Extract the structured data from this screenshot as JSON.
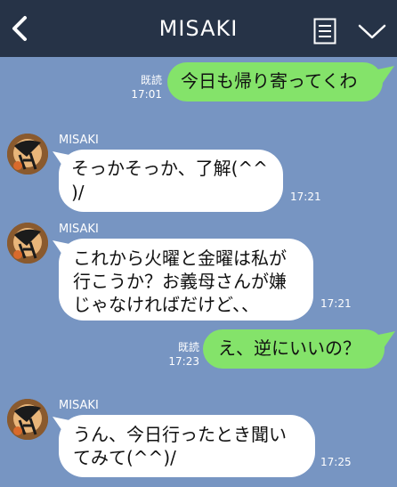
{
  "header": {
    "title": "MISAKI",
    "back_icon": "chevron-left-icon",
    "note_icon": "note-icon",
    "menu_icon": "chevron-down-icon",
    "background": "#263347"
  },
  "chat_background": "#7795c2",
  "messages": [
    {
      "direction": "out",
      "text": "今日も帰り寄ってくわ",
      "read_label": "既読",
      "time": "17:01"
    },
    {
      "direction": "in",
      "sender": "MISAKI",
      "text_line1": "そっかそっか、了解(^^",
      "text_line2": ")/",
      "time": "17:21"
    },
    {
      "direction": "in",
      "sender": "MISAKI",
      "text_line1": "これから火曜と金曜は私が",
      "text_line2": "行こうか？お義母さんが嫌",
      "text_line3": "じゃなければだけど、、",
      "time": "17:21"
    },
    {
      "direction": "out",
      "text": "え、逆にいいの？",
      "read_label": "既読",
      "time": "17:23"
    },
    {
      "direction": "in",
      "sender": "MISAKI",
      "text_line1": "うん、今日行ったとき聞い",
      "text_line2": "てみて(^^)/",
      "time": "17:25"
    }
  ],
  "colors": {
    "outgoing_bubble": "#84e36a",
    "incoming_bubble": "#ffffff"
  }
}
